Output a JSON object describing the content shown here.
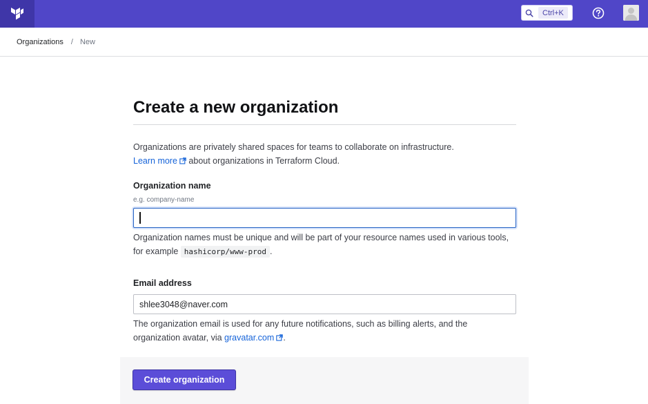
{
  "colors": {
    "topbar": "#5046c8",
    "logo_bg": "#3f36a8",
    "primary_button": "#5b4dd8",
    "link": "#1563d9",
    "focus_border": "#2563c4"
  },
  "header": {
    "logo_icon": "terraform-logo-icon",
    "search": {
      "icon": "search-icon",
      "shortcut": "Ctrl+K"
    },
    "help_icon": "help-circle-icon",
    "avatar_icon": "user-avatar-icon"
  },
  "breadcrumb": {
    "items": [
      {
        "label": "Organizations"
      },
      {
        "label": "New"
      }
    ],
    "separator": "/"
  },
  "main": {
    "title": "Create a new organization",
    "intro_text": "Organizations are privately shared spaces for teams to collaborate on infrastructure.",
    "learn_more_link": "Learn more",
    "intro_suffix": "about organizations in Terraform Cloud.",
    "org_name": {
      "label": "Organization name",
      "hint": "e.g. company-name",
      "value": "",
      "help_text": "Organization names must be unique and will be part of your resource names used in various tools, for example",
      "example_code": "hashicorp/www-prod",
      "help_suffix": "."
    },
    "email": {
      "label": "Email address",
      "value": "shlee3048@naver.com",
      "help_text": "The organization email is used for any future notifications, such as billing alerts, and the organization avatar, via",
      "gravatar_link": "gravatar.com",
      "help_suffix": "."
    },
    "submit_label": "Create organization"
  }
}
